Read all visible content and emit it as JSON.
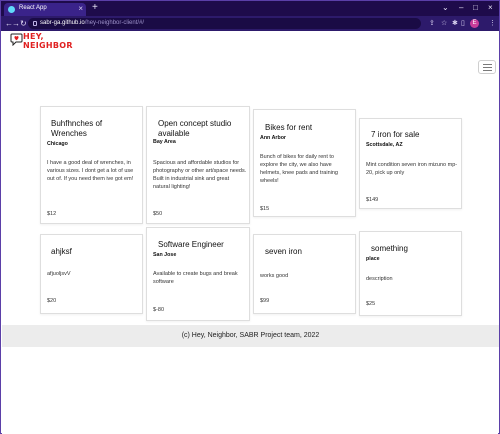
{
  "browser": {
    "tab_title": "React App",
    "tab_close": "×",
    "new_tab": "+",
    "url_host": "sabr-ga.github.io",
    "url_path": "/hey-neighbor-client/#/",
    "window_controls": [
      "⌄",
      "–",
      "□",
      "×"
    ],
    "nav": [
      "←",
      "→",
      "↻"
    ],
    "toolbar_icons": [
      "share-icon",
      "star-icon",
      "extension-icon",
      "sidebar-icon"
    ],
    "profile_initial": "E",
    "colors": {
      "frame": "#1e0b4b",
      "toolbar": "#2d1a6b",
      "omnibox": "#1a0b45"
    }
  },
  "header": {
    "logo_line1": "HEY,",
    "logo_line2": "NEIGHBOR",
    "brand_color": "#e02121"
  },
  "cards": [
    {
      "title": "Buhfhnches of Wrenches",
      "location": "Chicago",
      "description": "I have a good deal of wrenches, in various sizes. I dont get a lot of use out of. If you need them ive got em!",
      "price": "$12"
    },
    {
      "title": "Open concept studio available",
      "location": "Bay Area",
      "description": "Spacious and affordable studios for photography or other art/space needs. Built in industrial sink and great natural lighting!",
      "price": "$50"
    },
    {
      "title": "Bikes for rent",
      "location": "Ann Arbor",
      "description": "Bunch of bikes for daily rent to explore the city, we also have helmets, knee pads and training wheels!",
      "price": "$15"
    },
    {
      "title": "7 iron for sale",
      "location": "Scottsdale, AZ",
      "description": "Mint condition seven iron mizuno mp-20, pick up only",
      "price": "$149"
    },
    {
      "title": "ahjksf",
      "location": "",
      "description": "afjuoljsvV",
      "price": "$20"
    },
    {
      "title": "Software Engineer",
      "location": "San Jose",
      "description": "Available to create bugs and break software",
      "price": "$-80"
    },
    {
      "title": "seven iron",
      "location": "",
      "description": "works good",
      "price": "$99"
    },
    {
      "title": "something",
      "location": "place",
      "description": "description",
      "price": "$25"
    }
  ],
  "footer": {
    "text": "(c) Hey, Neighbor, SABR Project team, 2022"
  }
}
